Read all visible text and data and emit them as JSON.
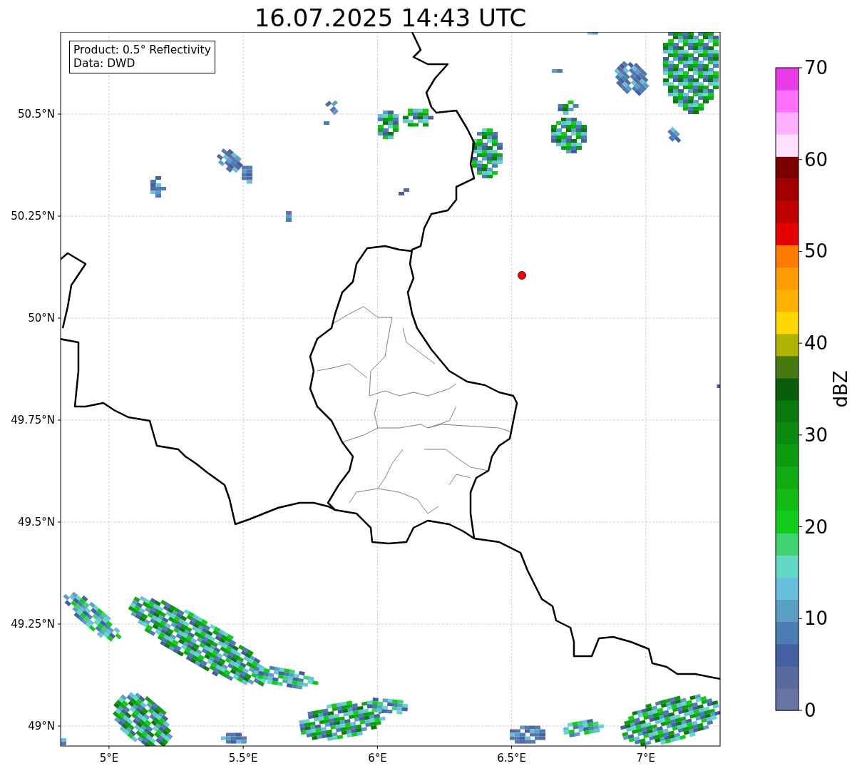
{
  "title": "16.07.2025 14:43 UTC",
  "legend": {
    "lines": [
      "Product: 0.5° Reflectivity",
      "Data: DWD"
    ]
  },
  "map": {
    "lat_ticks": [
      "50.5°N",
      "50.25°N",
      "50°N",
      "49.75°N",
      "49.5°N",
      "49.25°N",
      "49°N"
    ],
    "lon_ticks": [
      "5°E",
      "5.5°E",
      "6°E",
      "6.5°E",
      "7°E"
    ]
  },
  "colorbar": {
    "label": "dBZ",
    "ticks": [
      "70",
      "60",
      "50",
      "40",
      "30",
      "20",
      "10",
      "0"
    ],
    "segments": [
      {
        "color": "#6574a5"
      },
      {
        "color": "#566a9e"
      },
      {
        "color": "#4560a0"
      },
      {
        "color": "#4c7cb4"
      },
      {
        "color": "#5b9ec6"
      },
      {
        "color": "#68c0dc"
      },
      {
        "color": "#64d8c6"
      },
      {
        "color": "#40d470"
      },
      {
        "color": "#12cc1a"
      },
      {
        "color": "#12bc14"
      },
      {
        "color": "#10aa12"
      },
      {
        "color": "#0e9a10"
      },
      {
        "color": "#0c8a0e"
      },
      {
        "color": "#0a780c"
      },
      {
        "color": "#085e08"
      },
      {
        "color": "#487810"
      },
      {
        "color": "#b2b200"
      },
      {
        "color": "#ffd700"
      },
      {
        "color": "#ffb300"
      },
      {
        "color": "#ff9c00"
      },
      {
        "color": "#ff7c00"
      },
      {
        "color": "#e60000"
      },
      {
        "color": "#c00000"
      },
      {
        "color": "#a00000"
      },
      {
        "color": "#7a0000"
      },
      {
        "color": "#ffe0ff"
      },
      {
        "color": "#ffb0ff"
      },
      {
        "color": "#ff70ff"
      },
      {
        "color": "#e83ce8"
      }
    ]
  }
}
